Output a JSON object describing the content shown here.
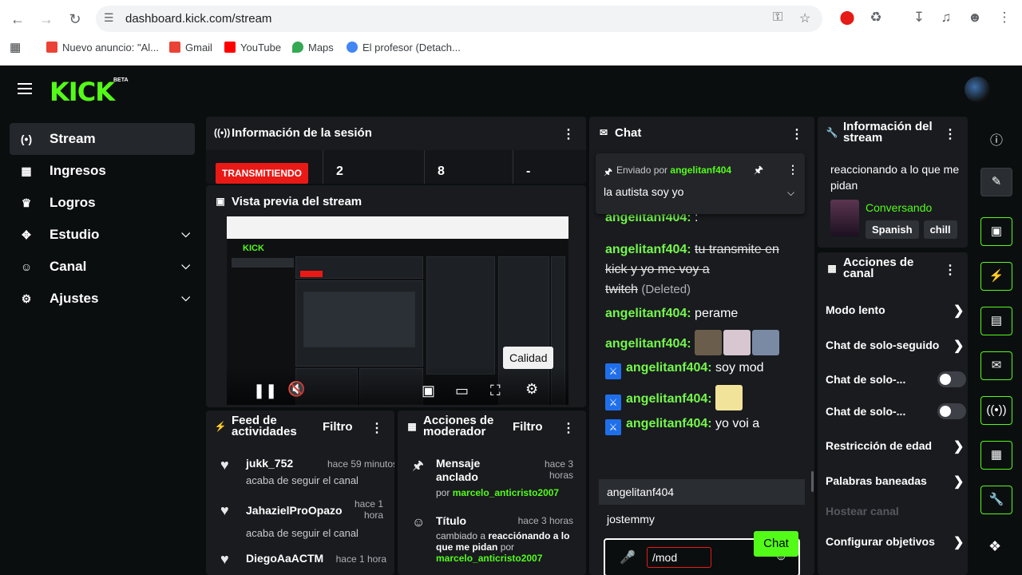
{
  "browser": {
    "url": "dashboard.kick.com/stream",
    "bookmarks": [
      {
        "label": "Nuevo anuncio: \"Al...",
        "icon": "gmail-icon",
        "color": "#ea4335"
      },
      {
        "label": "Gmail",
        "icon": "gmail-icon",
        "color": "#ea4335"
      },
      {
        "label": "YouTube",
        "icon": "youtube-icon",
        "color": "#ff0000"
      },
      {
        "label": "Maps",
        "icon": "maps-icon",
        "color": "#34a853"
      },
      {
        "label": "El profesor (Detach...",
        "icon": "google-icon",
        "color": "#4285f4"
      }
    ]
  },
  "app": {
    "logo": "KICK",
    "beta": "BETA"
  },
  "sidebar": {
    "items": [
      {
        "label": "Stream",
        "icon": "broadcast-icon",
        "active": true
      },
      {
        "label": "Ingresos",
        "icon": "revenue-icon"
      },
      {
        "label": "Logros",
        "icon": "trophy-icon"
      },
      {
        "label": "Estudio",
        "icon": "studio-icon",
        "expandable": true
      },
      {
        "label": "Canal",
        "icon": "channel-icon",
        "expandable": true
      },
      {
        "label": "Ajustes",
        "icon": "gear-icon",
        "expandable": true
      }
    ]
  },
  "session": {
    "title": "Información de la sesión",
    "live_badge": "TRANSMITIENDO",
    "stats": [
      "2",
      "8",
      "-"
    ]
  },
  "preview": {
    "title": "Vista previa del stream",
    "tooltip": "Calidad"
  },
  "activity": {
    "title": "Feed de actividades",
    "filter": "Filtro",
    "items": [
      {
        "name": "jukk_752",
        "time": "hace 59 minutos",
        "action": "acaba de seguir el canal"
      },
      {
        "name": "JahazielProOpazo",
        "time": "hace 1 hora",
        "action": "acaba de seguir el canal"
      },
      {
        "name": "DiegoAaACTM",
        "time": "hace 1 hora",
        "action": ""
      }
    ]
  },
  "modactions": {
    "title": "Acciones de moderador",
    "filter": "Filtro",
    "items": [
      {
        "title": "Mensaje anclado",
        "time": "hace 3 horas",
        "by_prefix": "por",
        "by": "marcelo_anticristo2007"
      },
      {
        "title": "Título",
        "time": "hace 3 horas",
        "desc_prefix": "cambiado a",
        "desc": "reacciónando a lo que me pidan",
        "by_prefix": "por",
        "by": "marcelo_anticristo2007"
      }
    ]
  },
  "chat": {
    "title": "Chat",
    "pinned_prefix": "Enviado por",
    "pinned_user": "angelitanf404",
    "pinned_text": "la autista soy yo",
    "messages": [
      {
        "user": "angelitanf404:",
        "text": ":"
      },
      {
        "user": "angelitanf404:",
        "text": "tu transmite en",
        "line2": "kick y yo me voy a",
        "line3": "twitch",
        "deleted": "(Deleted)"
      },
      {
        "user": "angelitanf404:",
        "text": "perame"
      },
      {
        "user": "angelitanf404:",
        "text": ""
      },
      {
        "user": "angelitanf404:",
        "text": "soy mod"
      },
      {
        "user": "angelitanf404:",
        "text": ""
      },
      {
        "user": "angelitanf404:",
        "text": "yo voi a"
      }
    ],
    "suggestions": [
      "angelitanf404",
      "jostemmy"
    ],
    "input_value": "/mod",
    "send_label": "Chat"
  },
  "stream_info": {
    "title": "Información del stream",
    "stream_title": "reaccionando a lo que me pidan",
    "category": "Conversando",
    "tags": [
      "Spanish",
      "chill"
    ]
  },
  "channel_actions": {
    "title": "Acciones de canal",
    "items": [
      {
        "label": "Modo lento",
        "type": "chevron"
      },
      {
        "label": "Chat de solo-seguido",
        "type": "chevron"
      },
      {
        "label": "Chat de solo-...",
        "type": "toggle"
      },
      {
        "label": "Chat de solo-...",
        "type": "toggle"
      },
      {
        "label": "Restricción de edad",
        "type": "chevron"
      },
      {
        "label": "Palabras baneadas",
        "type": "chevron"
      },
      {
        "label": "Hostear canal",
        "type": "disabled"
      },
      {
        "label": "Configurar objetivos",
        "type": "chevron"
      }
    ]
  },
  "colors": {
    "accent": "#53fc18",
    "live": "#e91916",
    "panel": "#191b1f"
  }
}
